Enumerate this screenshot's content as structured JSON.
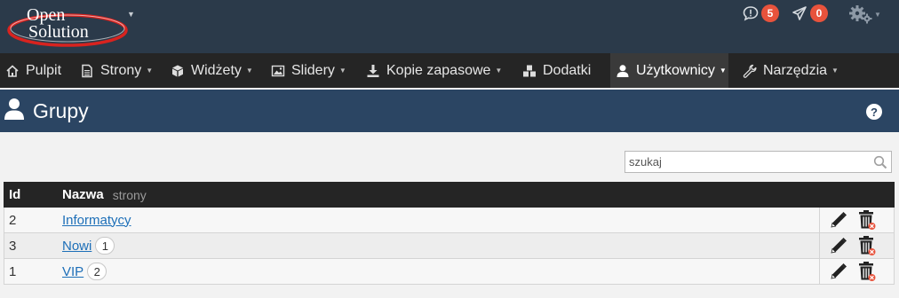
{
  "header": {
    "logo_line1": "Open",
    "logo_line2": "Solution",
    "notifications": [
      {
        "icon": "comment-alert-icon",
        "count": "5"
      },
      {
        "icon": "paper-plane-icon",
        "count": "0"
      }
    ],
    "settings_icon": "gear-icon"
  },
  "nav": {
    "items": [
      {
        "label": "Pulpit",
        "icon": "home-icon",
        "dropdown": false
      },
      {
        "label": "Strony",
        "icon": "document-icon",
        "dropdown": true
      },
      {
        "label": "Widżety",
        "icon": "cube-icon",
        "dropdown": true
      },
      {
        "label": "Slidery",
        "icon": "image-icon",
        "dropdown": true
      },
      {
        "label": "Kopie zapasowe",
        "icon": "download-icon",
        "dropdown": true
      },
      {
        "label": "Dodatki",
        "icon": "cubes-icon",
        "dropdown": false
      },
      {
        "label": "Użytkownicy",
        "icon": "user-icon",
        "dropdown": true,
        "active": true
      },
      {
        "label": "Narzędzia",
        "icon": "wrench-icon",
        "dropdown": true
      }
    ]
  },
  "page": {
    "title": "Grupy",
    "help_label": "?"
  },
  "search": {
    "placeholder": "szukaj",
    "value": ""
  },
  "table": {
    "columns": {
      "id": "Id",
      "name": "Nazwa",
      "name_sub": "strony"
    },
    "rows": [
      {
        "id": "2",
        "name": "Informatycy",
        "count": ""
      },
      {
        "id": "3",
        "name": "Nowi",
        "count": "1"
      },
      {
        "id": "1",
        "name": "VIP",
        "count": "2"
      }
    ]
  },
  "colors": {
    "header_bg": "#2b3a4a",
    "nav_bg": "#252525",
    "title_bg": "#2b4563",
    "badge": "#e8533c",
    "link": "#1d6fb8"
  }
}
